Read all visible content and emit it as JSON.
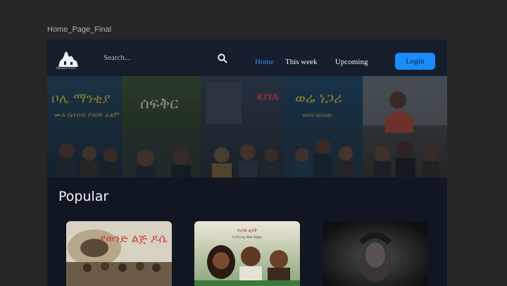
{
  "frame": {
    "label": "Home_Page_Final"
  },
  "brand": {
    "name": "Abyssinia Tickets",
    "logo_icon": "castle-logo-icon"
  },
  "search": {
    "placeholder": "Search...",
    "icon": "search-icon"
  },
  "nav": {
    "items": [
      {
        "label": "Home",
        "active": true
      },
      {
        "label": "This week",
        "active": false
      },
      {
        "label": "Upcoming",
        "active": false
      }
    ],
    "login_label": "Login"
  },
  "hero": {
    "posters": [
      {
        "title": "ቦሌ ማንቂያ",
        "subtitle": "ሙሉ ቤተሰብ ያለበት ፊልም"
      },
      {
        "title": "ሰፍቅር",
        "subtitle": ""
      },
      {
        "title": "KIYA",
        "subtitle": ""
      },
      {
        "title": "ወሬ ነጋሪ",
        "subtitle": "WERE NEGARI"
      },
      {
        "title": "",
        "subtitle": ""
      }
    ]
  },
  "popular": {
    "title": "Popular",
    "cards": [
      {
        "title": "የወንድ ልጅ ዶሴ"
      },
      {
        "title": "የአባይ ልጆች",
        "subtitle": "A Film by Abel Hagos"
      },
      {
        "title": ""
      }
    ]
  },
  "colors": {
    "background": "#262626",
    "frame": "#111722",
    "navbar": "#161e2b",
    "accent": "#1a8cff",
    "active_link": "#2e8cf0"
  }
}
